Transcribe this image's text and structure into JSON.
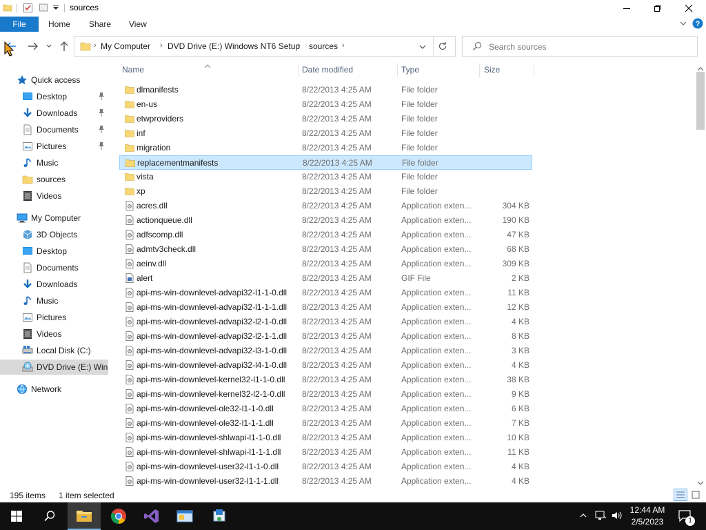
{
  "window": {
    "title": "sources",
    "controls": {
      "minimize": "─",
      "maximize": "☐",
      "close": "✕"
    }
  },
  "ribbon": {
    "tabs": [
      "File",
      "Home",
      "Share",
      "View"
    ]
  },
  "address": {
    "crumbs": [
      "My Computer",
      "DVD Drive (E:) Windows NT6 Setup",
      "sources"
    ],
    "separator": "›"
  },
  "search": {
    "placeholder": "Search sources"
  },
  "sidebar": {
    "quick_access": {
      "label": "Quick access",
      "items": [
        {
          "label": "Desktop",
          "icon": "desktop-icon",
          "pinned": true
        },
        {
          "label": "Downloads",
          "icon": "downloads-icon",
          "pinned": true
        },
        {
          "label": "Documents",
          "icon": "documents-icon",
          "pinned": true
        },
        {
          "label": "Pictures",
          "icon": "pictures-icon",
          "pinned": true
        },
        {
          "label": "Music",
          "icon": "music-icon",
          "pinned": false
        },
        {
          "label": "sources",
          "icon": "folder-icon",
          "pinned": false
        },
        {
          "label": "Videos",
          "icon": "videos-icon",
          "pinned": false
        }
      ]
    },
    "my_computer": {
      "label": "My Computer",
      "items": [
        {
          "label": "3D Objects",
          "icon": "3d-objects-icon"
        },
        {
          "label": "Desktop",
          "icon": "desktop-icon"
        },
        {
          "label": "Documents",
          "icon": "documents-icon"
        },
        {
          "label": "Downloads",
          "icon": "downloads-icon"
        },
        {
          "label": "Music",
          "icon": "music-icon"
        },
        {
          "label": "Pictures",
          "icon": "pictures-icon"
        },
        {
          "label": "Videos",
          "icon": "videos-icon"
        },
        {
          "label": "Local Disk (C:)",
          "icon": "local-disk-icon"
        },
        {
          "label": "DVD Drive (E:) Wind",
          "icon": "dvd-drive-icon",
          "selected": true
        }
      ]
    },
    "network": {
      "label": "Network"
    }
  },
  "columns": {
    "name": "Name",
    "date": "Date modified",
    "type": "Type",
    "size": "Size"
  },
  "files": [
    {
      "name": "dlmanifests",
      "date": "8/22/2013 4:25 AM",
      "type": "File folder",
      "size": "",
      "kind": "folder"
    },
    {
      "name": "en-us",
      "date": "8/22/2013 4:25 AM",
      "type": "File folder",
      "size": "",
      "kind": "folder"
    },
    {
      "name": "etwproviders",
      "date": "8/22/2013 4:25 AM",
      "type": "File folder",
      "size": "",
      "kind": "folder"
    },
    {
      "name": "inf",
      "date": "8/22/2013 4:25 AM",
      "type": "File folder",
      "size": "",
      "kind": "folder"
    },
    {
      "name": "migration",
      "date": "8/22/2013 4:25 AM",
      "type": "File folder",
      "size": "",
      "kind": "folder"
    },
    {
      "name": "replacementmanifests",
      "date": "8/22/2013 4:25 AM",
      "type": "File folder",
      "size": "",
      "kind": "folder",
      "selected": true
    },
    {
      "name": "vista",
      "date": "8/22/2013 4:25 AM",
      "type": "File folder",
      "size": "",
      "kind": "folder"
    },
    {
      "name": "xp",
      "date": "8/22/2013 4:25 AM",
      "type": "File folder",
      "size": "",
      "kind": "folder"
    },
    {
      "name": "acres.dll",
      "date": "8/22/2013 4:25 AM",
      "type": "Application exten...",
      "size": "304 KB",
      "kind": "dll"
    },
    {
      "name": "actionqueue.dll",
      "date": "8/22/2013 4:25 AM",
      "type": "Application exten...",
      "size": "190 KB",
      "kind": "dll"
    },
    {
      "name": "adfscomp.dll",
      "date": "8/22/2013 4:25 AM",
      "type": "Application exten...",
      "size": "47 KB",
      "kind": "dll"
    },
    {
      "name": "admtv3check.dll",
      "date": "8/22/2013 4:25 AM",
      "type": "Application exten...",
      "size": "68 KB",
      "kind": "dll"
    },
    {
      "name": "aeinv.dll",
      "date": "8/22/2013 4:25 AM",
      "type": "Application exten...",
      "size": "309 KB",
      "kind": "dll"
    },
    {
      "name": "alert",
      "date": "8/22/2013 4:25 AM",
      "type": "GIF File",
      "size": "2 KB",
      "kind": "gif"
    },
    {
      "name": "api-ms-win-downlevel-advapi32-l1-1-0.dll",
      "date": "8/22/2013 4:25 AM",
      "type": "Application exten...",
      "size": "11 KB",
      "kind": "dll"
    },
    {
      "name": "api-ms-win-downlevel-advapi32-l1-1-1.dll",
      "date": "8/22/2013 4:25 AM",
      "type": "Application exten...",
      "size": "12 KB",
      "kind": "dll"
    },
    {
      "name": "api-ms-win-downlevel-advapi32-l2-1-0.dll",
      "date": "8/22/2013 4:25 AM",
      "type": "Application exten...",
      "size": "4 KB",
      "kind": "dll"
    },
    {
      "name": "api-ms-win-downlevel-advapi32-l2-1-1.dll",
      "date": "8/22/2013 4:25 AM",
      "type": "Application exten...",
      "size": "8 KB",
      "kind": "dll"
    },
    {
      "name": "api-ms-win-downlevel-advapi32-l3-1-0.dll",
      "date": "8/22/2013 4:25 AM",
      "type": "Application exten...",
      "size": "3 KB",
      "kind": "dll"
    },
    {
      "name": "api-ms-win-downlevel-advapi32-l4-1-0.dll",
      "date": "8/22/2013 4:25 AM",
      "type": "Application exten...",
      "size": "4 KB",
      "kind": "dll"
    },
    {
      "name": "api-ms-win-downlevel-kernel32-l1-1-0.dll",
      "date": "8/22/2013 4:25 AM",
      "type": "Application exten...",
      "size": "38 KB",
      "kind": "dll"
    },
    {
      "name": "api-ms-win-downlevel-kernel32-l2-1-0.dll",
      "date": "8/22/2013 4:25 AM",
      "type": "Application exten...",
      "size": "9 KB",
      "kind": "dll"
    },
    {
      "name": "api-ms-win-downlevel-ole32-l1-1-0.dll",
      "date": "8/22/2013 4:25 AM",
      "type": "Application exten...",
      "size": "6 KB",
      "kind": "dll"
    },
    {
      "name": "api-ms-win-downlevel-ole32-l1-1-1.dll",
      "date": "8/22/2013 4:25 AM",
      "type": "Application exten...",
      "size": "7 KB",
      "kind": "dll"
    },
    {
      "name": "api-ms-win-downlevel-shlwapi-l1-1-0.dll",
      "date": "8/22/2013 4:25 AM",
      "type": "Application exten...",
      "size": "10 KB",
      "kind": "dll"
    },
    {
      "name": "api-ms-win-downlevel-shlwapi-l1-1-1.dll",
      "date": "8/22/2013 4:25 AM",
      "type": "Application exten...",
      "size": "11 KB",
      "kind": "dll"
    },
    {
      "name": "api-ms-win-downlevel-user32-l1-1-0.dll",
      "date": "8/22/2013 4:25 AM",
      "type": "Application exten...",
      "size": "4 KB",
      "kind": "dll"
    },
    {
      "name": "api-ms-win-downlevel-user32-l1-1-1.dll",
      "date": "8/22/2013 4:25 AM",
      "type": "Application exten...",
      "size": "4 KB",
      "kind": "dll"
    }
  ],
  "status": {
    "item_count": "195 items",
    "selection": "1 item selected"
  },
  "taskbar": {
    "apps": [
      {
        "name": "start-button"
      },
      {
        "name": "search-button"
      },
      {
        "name": "file-explorer-app",
        "active": true
      },
      {
        "name": "chrome-app"
      },
      {
        "name": "visual-studio-app"
      },
      {
        "name": "app-window-1"
      },
      {
        "name": "app-window-2"
      }
    ],
    "time": "12:44 AM",
    "date": "2/5/2023",
    "notification_count": "1"
  },
  "colors": {
    "accent": "#1979ca",
    "selection_bg": "#cce8ff",
    "selection_border": "#99d1ff",
    "folder": "#f8d775",
    "taskbar": "#101010"
  }
}
